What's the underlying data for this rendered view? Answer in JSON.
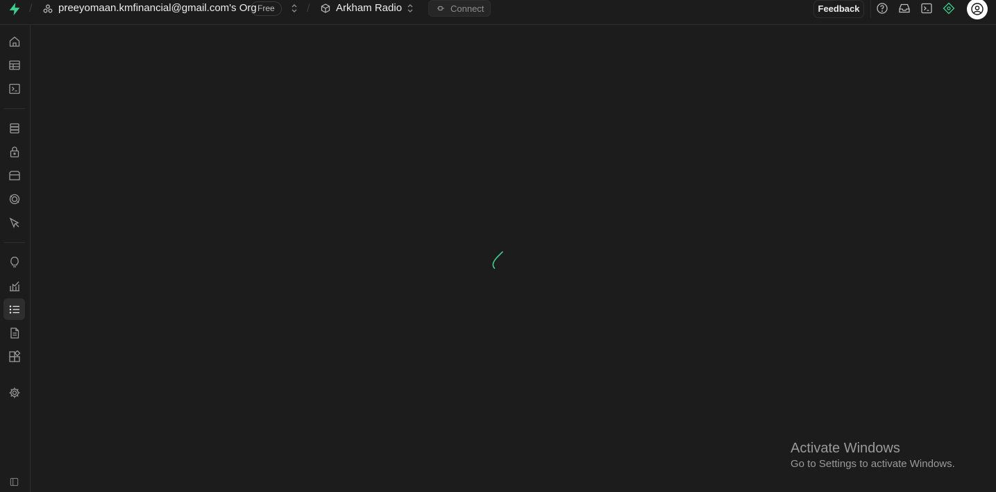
{
  "topbar": {
    "org_name": "preeyomaan.kmfinancial@gmail.com's Org",
    "plan_badge": "Free",
    "project_name": "Arkham Radio",
    "connect_label": "Connect",
    "feedback_label": "Feedback",
    "icons": [
      "help-icon",
      "inbox-icon",
      "terminal-icon",
      "advisor-icon",
      "user-icon"
    ]
  },
  "sidebar": {
    "items": [
      {
        "icon": "home-icon",
        "active": false
      },
      {
        "icon": "table-editor-icon",
        "active": false
      },
      {
        "icon": "sql-editor-icon",
        "active": false
      },
      {
        "icon": "database-icon",
        "active": false
      },
      {
        "icon": "authentication-icon",
        "active": false
      },
      {
        "icon": "storage-icon",
        "active": false
      },
      {
        "icon": "realtime-icon",
        "active": false
      },
      {
        "icon": "edge-functions-icon",
        "active": false
      },
      {
        "icon": "advisors-icon",
        "active": false
      },
      {
        "icon": "reports-icon",
        "active": false
      },
      {
        "icon": "logs-icon",
        "active": true
      },
      {
        "icon": "api-docs-icon",
        "active": false
      },
      {
        "icon": "integrations-icon",
        "active": false
      },
      {
        "icon": "settings-icon",
        "active": false
      },
      {
        "icon": "collapse-sidebar-icon",
        "active": false
      }
    ]
  },
  "colors": {
    "background": "#1c1c1c",
    "border": "#2e2e2e",
    "accent": "#3ecf8e",
    "text": "#ededed",
    "muted": "#8f8f8f"
  },
  "watermark": {
    "title": "Activate Windows",
    "subtitle": "Go to Settings to activate Windows."
  }
}
